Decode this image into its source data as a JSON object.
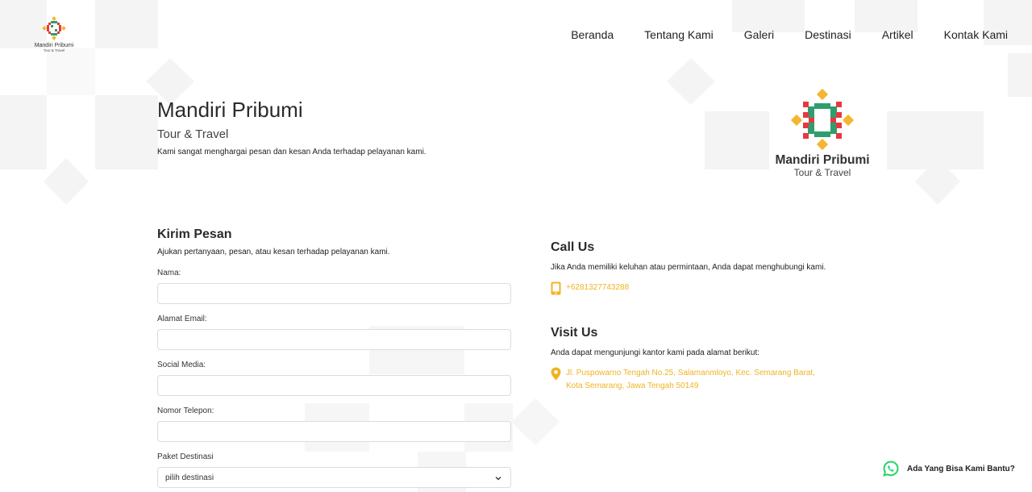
{
  "header": {
    "brand_name": "Mandiri Pribumi",
    "brand_sub": "Tour & Travel",
    "nav": [
      "Beranda",
      "Tentang Kami",
      "Galeri",
      "Destinasi",
      "Artikel",
      "Kontak Kami"
    ]
  },
  "hero": {
    "title": "Mandiri Pribumi",
    "subtitle": "Tour & Travel",
    "description": "Kami sangat menghargai pesan dan kesan Anda terhadap pelayanan kami.",
    "logo_name": "Mandiri Pribumi",
    "logo_sub": "Tour & Travel"
  },
  "form": {
    "title": "Kirim Pesan",
    "description": "Ajukan pertanyaan, pesan, atau kesan terhadap pelayanan kami.",
    "name_label": "Nama:",
    "email_label": "Alamat Email:",
    "social_label": "Social Media:",
    "phone_label": "Nomor Telepon:",
    "package_label": "Paket Destinasi",
    "package_selected": "pilih destinasi"
  },
  "contact": {
    "call_title": "Call Us",
    "call_desc": "Jika Anda memiliki keluhan atau permintaan, Anda dapat menghubungi kami.",
    "phone": "+6281327743288",
    "visit_title": "Visit Us",
    "visit_desc": "Anda dapat mengunjungi kantor kami pada alamat berikut:",
    "address": "Jl. Puspowarno Tengah No.25, Salamanmloyo, Kec. Semarang Barat, Kota Semarang, Jawa Tengah 50149"
  },
  "whatsapp": {
    "label": "Ada Yang Bisa Kami Bantu?"
  },
  "colors": {
    "accent": "#f0b323",
    "logo_red": "#e5393f",
    "logo_green": "#2e9e6e",
    "logo_yellow": "#f4b630",
    "whatsapp": "#25d366"
  }
}
